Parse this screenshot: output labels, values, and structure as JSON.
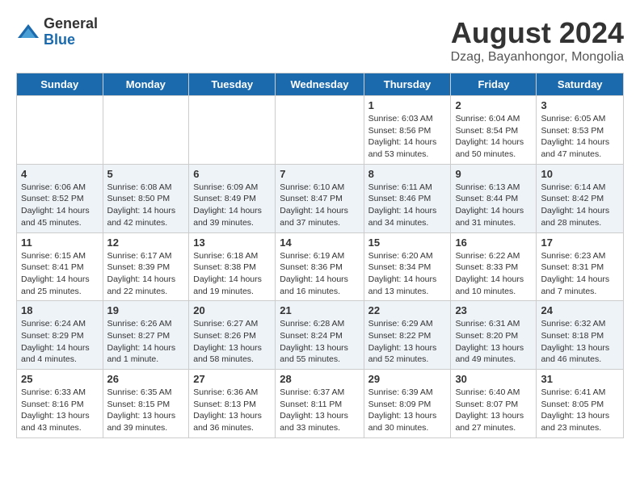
{
  "logo": {
    "general": "General",
    "blue": "Blue"
  },
  "title": "August 2024",
  "location": "Dzag, Bayanhongor, Mongolia",
  "days": [
    "Sunday",
    "Monday",
    "Tuesday",
    "Wednesday",
    "Thursday",
    "Friday",
    "Saturday"
  ],
  "weeks": [
    [
      {
        "date": "",
        "info": ""
      },
      {
        "date": "",
        "info": ""
      },
      {
        "date": "",
        "info": ""
      },
      {
        "date": "",
        "info": ""
      },
      {
        "date": "1",
        "info": "Sunrise: 6:03 AM\nSunset: 8:56 PM\nDaylight: 14 hours and 53 minutes."
      },
      {
        "date": "2",
        "info": "Sunrise: 6:04 AM\nSunset: 8:54 PM\nDaylight: 14 hours and 50 minutes."
      },
      {
        "date": "3",
        "info": "Sunrise: 6:05 AM\nSunset: 8:53 PM\nDaylight: 14 hours and 47 minutes."
      }
    ],
    [
      {
        "date": "4",
        "info": "Sunrise: 6:06 AM\nSunset: 8:52 PM\nDaylight: 14 hours and 45 minutes."
      },
      {
        "date": "5",
        "info": "Sunrise: 6:08 AM\nSunset: 8:50 PM\nDaylight: 14 hours and 42 minutes."
      },
      {
        "date": "6",
        "info": "Sunrise: 6:09 AM\nSunset: 8:49 PM\nDaylight: 14 hours and 39 minutes."
      },
      {
        "date": "7",
        "info": "Sunrise: 6:10 AM\nSunset: 8:47 PM\nDaylight: 14 hours and 37 minutes."
      },
      {
        "date": "8",
        "info": "Sunrise: 6:11 AM\nSunset: 8:46 PM\nDaylight: 14 hours and 34 minutes."
      },
      {
        "date": "9",
        "info": "Sunrise: 6:13 AM\nSunset: 8:44 PM\nDaylight: 14 hours and 31 minutes."
      },
      {
        "date": "10",
        "info": "Sunrise: 6:14 AM\nSunset: 8:42 PM\nDaylight: 14 hours and 28 minutes."
      }
    ],
    [
      {
        "date": "11",
        "info": "Sunrise: 6:15 AM\nSunset: 8:41 PM\nDaylight: 14 hours and 25 minutes."
      },
      {
        "date": "12",
        "info": "Sunrise: 6:17 AM\nSunset: 8:39 PM\nDaylight: 14 hours and 22 minutes."
      },
      {
        "date": "13",
        "info": "Sunrise: 6:18 AM\nSunset: 8:38 PM\nDaylight: 14 hours and 19 minutes."
      },
      {
        "date": "14",
        "info": "Sunrise: 6:19 AM\nSunset: 8:36 PM\nDaylight: 14 hours and 16 minutes."
      },
      {
        "date": "15",
        "info": "Sunrise: 6:20 AM\nSunset: 8:34 PM\nDaylight: 14 hours and 13 minutes."
      },
      {
        "date": "16",
        "info": "Sunrise: 6:22 AM\nSunset: 8:33 PM\nDaylight: 14 hours and 10 minutes."
      },
      {
        "date": "17",
        "info": "Sunrise: 6:23 AM\nSunset: 8:31 PM\nDaylight: 14 hours and 7 minutes."
      }
    ],
    [
      {
        "date": "18",
        "info": "Sunrise: 6:24 AM\nSunset: 8:29 PM\nDaylight: 14 hours and 4 minutes."
      },
      {
        "date": "19",
        "info": "Sunrise: 6:26 AM\nSunset: 8:27 PM\nDaylight: 14 hours and 1 minute."
      },
      {
        "date": "20",
        "info": "Sunrise: 6:27 AM\nSunset: 8:26 PM\nDaylight: 13 hours and 58 minutes."
      },
      {
        "date": "21",
        "info": "Sunrise: 6:28 AM\nSunset: 8:24 PM\nDaylight: 13 hours and 55 minutes."
      },
      {
        "date": "22",
        "info": "Sunrise: 6:29 AM\nSunset: 8:22 PM\nDaylight: 13 hours and 52 minutes."
      },
      {
        "date": "23",
        "info": "Sunrise: 6:31 AM\nSunset: 8:20 PM\nDaylight: 13 hours and 49 minutes."
      },
      {
        "date": "24",
        "info": "Sunrise: 6:32 AM\nSunset: 8:18 PM\nDaylight: 13 hours and 46 minutes."
      }
    ],
    [
      {
        "date": "25",
        "info": "Sunrise: 6:33 AM\nSunset: 8:16 PM\nDaylight: 13 hours and 43 minutes."
      },
      {
        "date": "26",
        "info": "Sunrise: 6:35 AM\nSunset: 8:15 PM\nDaylight: 13 hours and 39 minutes."
      },
      {
        "date": "27",
        "info": "Sunrise: 6:36 AM\nSunset: 8:13 PM\nDaylight: 13 hours and 36 minutes."
      },
      {
        "date": "28",
        "info": "Sunrise: 6:37 AM\nSunset: 8:11 PM\nDaylight: 13 hours and 33 minutes."
      },
      {
        "date": "29",
        "info": "Sunrise: 6:39 AM\nSunset: 8:09 PM\nDaylight: 13 hours and 30 minutes."
      },
      {
        "date": "30",
        "info": "Sunrise: 6:40 AM\nSunset: 8:07 PM\nDaylight: 13 hours and 27 minutes."
      },
      {
        "date": "31",
        "info": "Sunrise: 6:41 AM\nSunset: 8:05 PM\nDaylight: 13 hours and 23 minutes."
      }
    ]
  ]
}
